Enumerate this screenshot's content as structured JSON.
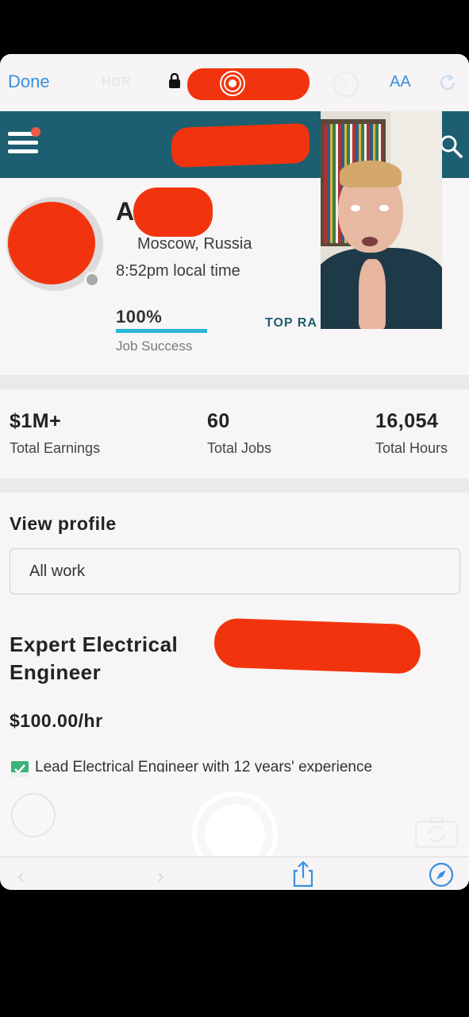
{
  "browser": {
    "done_label": "Done",
    "camera_mode_label": "HDR",
    "text_size_label": "AA"
  },
  "profile": {
    "name_visible": "A",
    "location": "Moscow, Russia",
    "local_time": "8:52pm local time",
    "job_success_value": "100%",
    "job_success_fraction": 1.0,
    "job_success_label": "Job Success",
    "top_rated_label": "TOP RA"
  },
  "stats": [
    {
      "value": "$1M+",
      "label": "Total Earnings"
    },
    {
      "value": "60",
      "label": "Total Jobs"
    },
    {
      "value": "16,054",
      "label": "Total Hours"
    }
  ],
  "section": {
    "view_profile_title": "View profile",
    "work_filter_value": "All work",
    "headline": "Expert Electrical Engineer",
    "hourly_rate": "$100.00/hr",
    "description_first_line": "Lead Electrical Engineer with 12 years' experience"
  },
  "colors": {
    "header_teal": "#1d5f71",
    "accent_blue": "#29b6d8",
    "redaction_red": "#f2340e",
    "safari_blue": "#3a8ee0"
  },
  "icons": [
    "lock-icon",
    "record-icon",
    "timer-icon",
    "reload-icon",
    "hamburger-menu-icon",
    "search-icon",
    "checkbox-icon",
    "camera-flip-icon",
    "share-icon",
    "compass-icon",
    "back-arrow-icon",
    "forward-arrow-icon"
  ]
}
